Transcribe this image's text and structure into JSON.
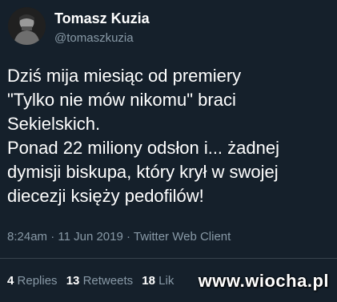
{
  "author": {
    "name": "Tomasz Kuzia",
    "handle": "@tomaszkuzia",
    "avatar_icon": "profile-photo"
  },
  "tweet": {
    "lines": [
      "Dziś mija miesiąc od premiery",
      "\"Tylko nie mów nikomu\" braci",
      "Sekielskich.",
      "Ponad 22 miliony odsłon i... żadnej",
      "dymisji biskupa, który krył w swojej",
      "diecezji księży pedofilów!"
    ],
    "meta": "8:24am · 11 Jun 2019 · Twitter Web Client"
  },
  "stats": {
    "replies_count": "4",
    "replies_label": "Replies",
    "retweets_count": "13",
    "retweets_label": "Retweets",
    "likes_count": "18",
    "likes_label": "Lik"
  },
  "watermark": "www.wiocha.pl",
  "colors": {
    "background": "#15202b",
    "secondary_text": "#8899a6",
    "divider": "#38444d"
  }
}
